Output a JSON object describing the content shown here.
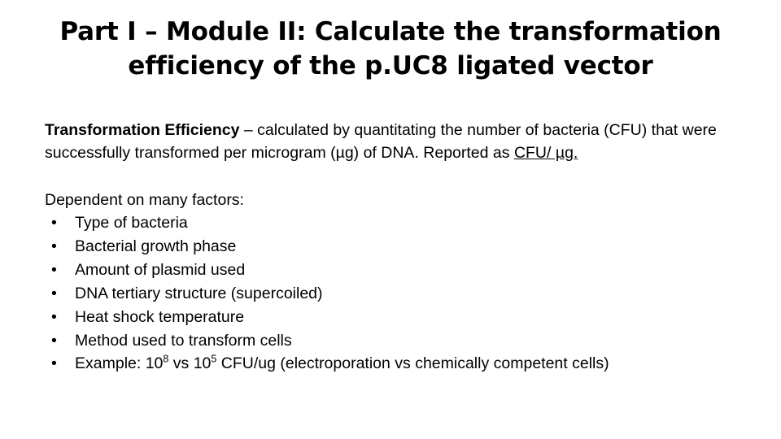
{
  "slide": {
    "title_lines": [
      "Part I – Module II: Calculate the transformation",
      "efficiency of the p.UC8 ligated vector"
    ],
    "paragraph": {
      "term": "Transformation Efficiency",
      "text_1": " – calculated by quantitating the number of bacteria (CFU) that were successfully transformed per microgram (µg) of DNA.  Reported as ",
      "underlined": "CFU/ µg."
    },
    "section_heading": "Dependent on many factors:",
    "bullet_marker": "•",
    "bullets": [
      {
        "text": "Type of bacteria"
      },
      {
        "text": "Bacterial growth phase"
      },
      {
        "text": "Amount of plasmid used"
      },
      {
        "text": "DNA tertiary structure (supercoiled)"
      },
      {
        "text": "Heat shock temperature"
      },
      {
        "text": "Method used to transform cells"
      }
    ],
    "example_bullet": {
      "prefix": "Example: 10",
      "exp_1": "8",
      "middle": " vs 10",
      "exp_2": "5",
      "suffix": " CFU/ug (electroporation vs chemically competent cells)"
    },
    "colors": {
      "text": "#000000",
      "background": "#ffffff"
    }
  }
}
